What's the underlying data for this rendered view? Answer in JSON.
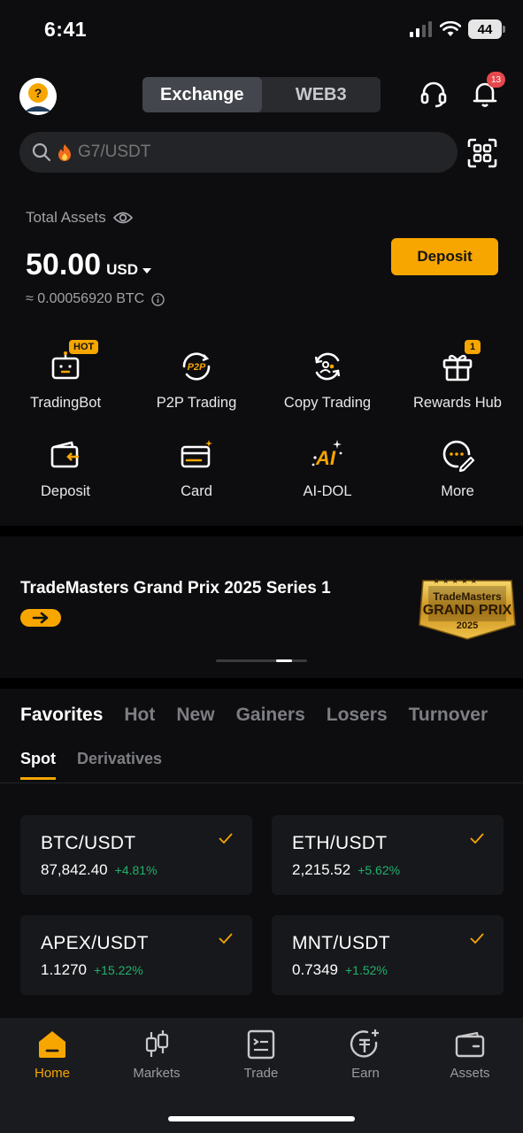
{
  "status": {
    "time": "6:41",
    "battery": "44"
  },
  "header": {
    "segments": [
      "Exchange",
      "WEB3"
    ],
    "notifications_count": "13"
  },
  "search": {
    "placeholder": "G7/USDT"
  },
  "assets": {
    "label": "Total Assets",
    "amount": "50.00",
    "currency": "USD",
    "btc_equiv": "≈ 0.00056920 BTC",
    "deposit_label": "Deposit"
  },
  "shortcuts": [
    {
      "label": "TradingBot",
      "icon": "robot-icon",
      "badge": "HOT"
    },
    {
      "label": "P2P Trading",
      "icon": "p2p-icon",
      "badge": ""
    },
    {
      "label": "Copy Trading",
      "icon": "copy-trading-icon",
      "badge": ""
    },
    {
      "label": "Rewards Hub",
      "icon": "gift-icon",
      "badge": "1"
    },
    {
      "label": "Deposit",
      "icon": "wallet-deposit-icon",
      "badge": ""
    },
    {
      "label": "Card",
      "icon": "card-icon",
      "badge": ""
    },
    {
      "label": "AI-DOL",
      "icon": "ai-icon",
      "badge": ""
    },
    {
      "label": "More",
      "icon": "more-icon",
      "badge": ""
    }
  ],
  "banner": {
    "title": "TradeMasters Grand Prix 2025 Series 1",
    "logo_line1": "TradeMasters",
    "logo_line2": "GRAND PRIX",
    "logo_line3": "2025"
  },
  "market_tabs": [
    "Favorites",
    "Hot",
    "New",
    "Gainers",
    "Losers",
    "Turnover"
  ],
  "sub_tabs": [
    "Spot",
    "Derivatives"
  ],
  "favorites": [
    {
      "pair": "BTC/USDT",
      "price": "87,842.40",
      "change": "+4.81%"
    },
    {
      "pair": "ETH/USDT",
      "price": "2,215.52",
      "change": "+5.62%"
    },
    {
      "pair": "APEX/USDT",
      "price": "1.1270",
      "change": "+15.22%"
    },
    {
      "pair": "MNT/USDT",
      "price": "0.7349",
      "change": "+1.52%"
    }
  ],
  "bottom_nav": [
    "Home",
    "Markets",
    "Trade",
    "Earn",
    "Assets"
  ],
  "colors": {
    "accent": "#f7a600",
    "positive": "#20b26c",
    "background": "#0d0d0f"
  }
}
